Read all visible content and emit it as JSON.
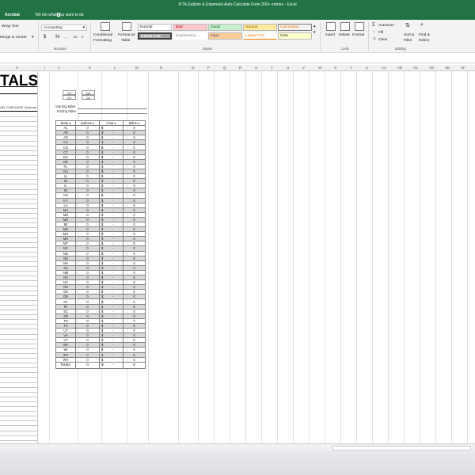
{
  "window": {
    "title": "IFTA Gallons & Expenses Auto-Calculate Form 200+ entries  -  Excel"
  },
  "tabs": {
    "acrobat": "Acrobat",
    "tell_me": "Tell me what you want to do"
  },
  "ribbon": {
    "alignment": {
      "wrap_text": "Wrap Text",
      "merge_center": "Merge & Center"
    },
    "number": {
      "format": "Accounting",
      "currency": "$",
      "percent": "%",
      "comma": ",",
      "group_label": "Number"
    },
    "styles": {
      "conditional": "Conditional",
      "formatting": "Formatting",
      "format_as": "Format as",
      "table": "Table",
      "normal": "Normal",
      "bad": "Bad",
      "good": "Good",
      "neutral": "Neutral",
      "calculation": "Calculation",
      "check_cell": "Check Cell",
      "explanatory": "Explanatory ...",
      "input": "Input",
      "linked_cell": "Linked Cell",
      "note": "Note",
      "group_label": "Styles"
    },
    "cells": {
      "insert": "Insert",
      "delete": "Delete",
      "format": "Format",
      "group_label": "Cells"
    },
    "editing": {
      "autosum": "AutoSum",
      "fill": "Fill",
      "clear": "Clear",
      "sort_filter_1": "Sort &",
      "sort_filter_2": "Filter",
      "find_select_1": "Find &",
      "find_select_2": "Select",
      "group_label": "Editing"
    }
  },
  "columns": [
    "H",
    "I",
    "J",
    "K",
    "L",
    "M",
    "N",
    "O",
    "P",
    "Q",
    "R",
    "S",
    "T",
    "U",
    "V",
    "W",
    "X",
    "Y",
    "Z",
    "AA",
    "AB",
    "AC",
    "AD",
    "AE",
    "AF",
    "AG"
  ],
  "sheet": {
    "title": "TALS",
    "fuel_label": "UEL PURCHASE (Gallons)",
    "quarters": [
      "Q1",
      "Q2",
      "Q3",
      "Q4"
    ],
    "starting_miles": "Starting Miles",
    "ending_miles": "Ending Miles",
    "headers": {
      "state": "State",
      "gallons": "Gallons",
      "cost": "Cost",
      "miles": "Miles"
    },
    "states": [
      "AL",
      "AR",
      "AZ",
      "CA",
      "CO",
      "CT",
      "DC",
      "DE",
      "FL",
      "GA",
      "IA",
      "ID",
      "IL",
      "IN",
      "KS",
      "KY",
      "LA",
      "MA",
      "MD",
      "ME",
      "MI",
      "MN",
      "MO",
      "MS",
      "MT",
      "NC",
      "ND",
      "NE",
      "NH",
      "NJ",
      "NM",
      "NV",
      "NY",
      "OH",
      "OK",
      "OR",
      "PA",
      "RI",
      "SC",
      "SD",
      "TN",
      "TX",
      "UT",
      "VA",
      "VT",
      "WA",
      "WI",
      "WV",
      "WY"
    ],
    "zero": "0",
    "dollar": "$",
    "dash": "-",
    "totals_label": "Totals:",
    "totals": {
      "gallons": "0",
      "cost_symbol": "$",
      "cost_value": "-",
      "miles": "0"
    }
  }
}
